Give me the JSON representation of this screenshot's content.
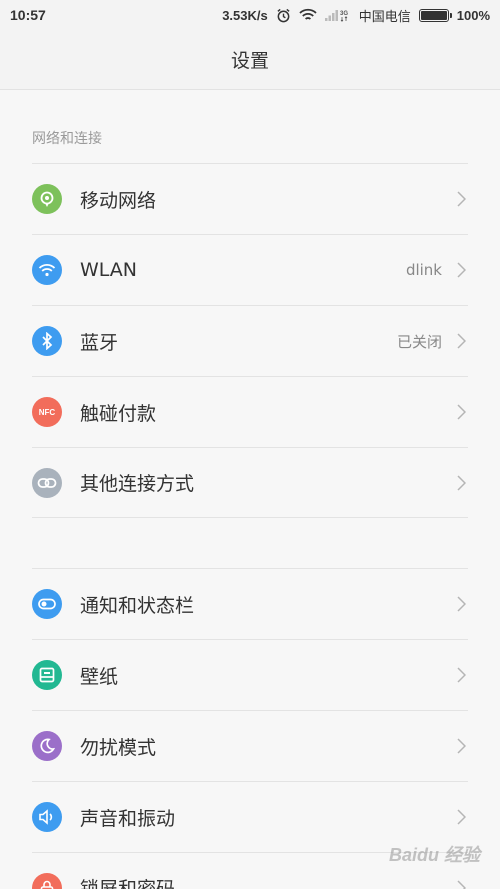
{
  "status_bar": {
    "time": "10:57",
    "speed": "3.53K/s",
    "network_type": "3G",
    "carrier": "中国电信",
    "battery": "100%",
    "battery_level": 1.0
  },
  "header": {
    "title": "设置"
  },
  "network_section": {
    "header": "网络和连接",
    "items": [
      {
        "label": "移动网络",
        "value": "",
        "icon": "mobile-network-icon",
        "color": "#7dc15b"
      },
      {
        "label": "WLAN",
        "value": "dlink",
        "icon": "wifi-icon",
        "color": "#3e9cf0"
      },
      {
        "label": "蓝牙",
        "value": "已关闭",
        "icon": "bluetooth-icon",
        "color": "#3e9cf0"
      },
      {
        "label": "触碰付款",
        "value": "",
        "icon": "nfc-icon",
        "color": "#f26d5b"
      },
      {
        "label": "其他连接方式",
        "value": "",
        "icon": "link-icon",
        "color": "#a9b2bc"
      }
    ]
  },
  "device_section": {
    "items": [
      {
        "label": "通知和状态栏",
        "icon": "notification-icon",
        "color": "#3e9cf0"
      },
      {
        "label": "壁纸",
        "icon": "wallpaper-icon",
        "color": "#22b892"
      },
      {
        "label": "勿扰模式",
        "icon": "moon-icon",
        "color": "#9b6fc9"
      },
      {
        "label": "声音和振动",
        "icon": "speaker-icon",
        "color": "#3e9cf0"
      },
      {
        "label": "锁屏和密码",
        "icon": "lock-icon",
        "color": "#f26d5b"
      }
    ]
  },
  "watermark": "Baidu 经验"
}
